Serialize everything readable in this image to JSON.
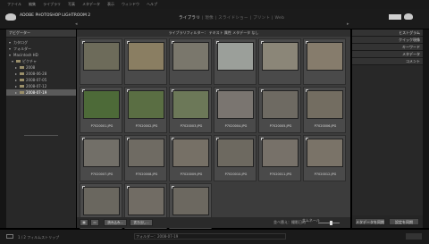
{
  "menubar": {
    "items": [
      "ファイル",
      "編集",
      "ライブラリ",
      "写真",
      "メタデータ",
      "表示",
      "ウィンドウ",
      "ヘルプ"
    ]
  },
  "header": {
    "app_name": "ADOBE PHOTOSHOP LIGHTROOM 2",
    "app_sub": "",
    "modules": [
      "ライブラリ",
      "現像",
      "スライドショー",
      "プリント",
      "Web"
    ],
    "active_module": "ライブラリ",
    "right_name": "ライブラリ"
  },
  "left_panel": {
    "header": "ナビゲーター",
    "rows": [
      {
        "label": "カタログ",
        "indent": 0,
        "type": "header"
      },
      {
        "label": "フォルダー",
        "indent": 0,
        "type": "header"
      },
      {
        "label": "Macintosh HD",
        "indent": 0,
        "type": "folder"
      },
      {
        "label": "ピクチャ",
        "indent": 1,
        "type": "folder"
      },
      {
        "label": "2008",
        "indent": 2,
        "type": "folder"
      },
      {
        "label": "2008-06-28",
        "indent": 2,
        "type": "folder"
      },
      {
        "label": "2008-07-05",
        "indent": 2,
        "type": "folder"
      },
      {
        "label": "2008-07-12",
        "indent": 2,
        "type": "folder"
      },
      {
        "label": "2008-07-19",
        "indent": 2,
        "type": "folder",
        "selected": true
      }
    ]
  },
  "center": {
    "tabs": "ライブラリフィルター：  テキスト  属性  メタデータ  なし",
    "photos": [
      {
        "caption": "",
        "color": "#6d6b5a"
      },
      {
        "caption": "",
        "color": "#8a7e62"
      },
      {
        "caption": "",
        "color": "#7a776c"
      },
      {
        "caption": "",
        "color": "#9b9f9a"
      },
      {
        "caption": "",
        "color": "#8b8678"
      },
      {
        "caption": "",
        "color": "#867c6c"
      },
      {
        "caption": "P7020001.JPG",
        "color": "#4d6a38",
        "selected": false
      },
      {
        "caption": "P7020002.JPG",
        "color": "#5a6e43"
      },
      {
        "caption": "P7020003.JPG",
        "color": "#6c7858"
      },
      {
        "caption": "P7020004.JPG",
        "color": "#7a7570"
      },
      {
        "caption": "P7020005.JPG",
        "color": "#6e6a62"
      },
      {
        "caption": "P7020006.JPG",
        "color": "#736d61"
      },
      {
        "caption": "P7020007.JPG",
        "color": "#726f68"
      },
      {
        "caption": "P7020008.JPG",
        "color": "#6f6b63"
      },
      {
        "caption": "P7020009.JPG",
        "color": "#767066"
      },
      {
        "caption": "P7020010.JPG",
        "color": "#6d6960"
      },
      {
        "caption": "P7020011.JPG",
        "color": "#777169"
      },
      {
        "caption": "P7020012.JPG",
        "color": "#7a7368"
      },
      {
        "caption": "P7020013.JPG",
        "color": "#6a675f"
      },
      {
        "caption": "P7020014.JPG",
        "color": "#716c64"
      },
      {
        "caption": "P7020015.JPG",
        "color": "#6c6860"
      }
    ],
    "toolbar": {
      "import_label": "読み込み...",
      "export_label": "書き出し...",
      "sort_label": "並べ替え：撮影日時",
      "thumbs_label": "サムネール"
    }
  },
  "right_panel": {
    "headers": [
      "ヒストグラム",
      "クイック現像",
      "キーワード",
      "メタデータ",
      "コメント"
    ],
    "sync_meta": "メタデータを同期",
    "sync_settings": "設定を同期"
  },
  "filmstrip": {
    "left_text": "1 / 2 フィルムストリップ",
    "center_text": "フォルダー：2008-07-19"
  }
}
